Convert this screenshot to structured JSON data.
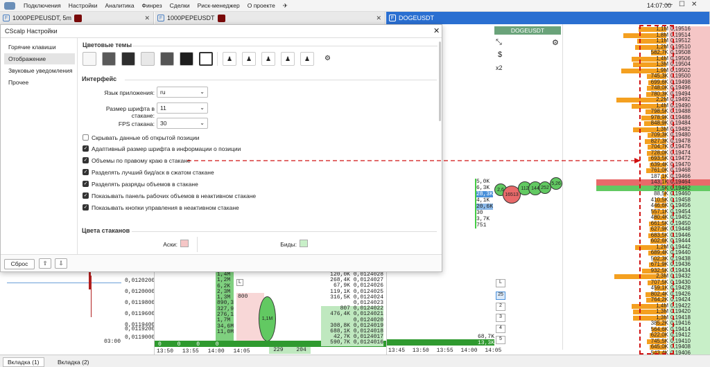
{
  "menu": [
    "Подключения",
    "Настройки",
    "Аналитика",
    "Финрез",
    "Сделки",
    "Риск-менеджер",
    "О проекте"
  ],
  "clock": "14:07:00",
  "tabs": [
    {
      "label": "1000PEPEUSDT, 5m"
    },
    {
      "label": "1000PEPEUSDT"
    },
    {
      "label": "DOGEUSDT"
    }
  ],
  "dialog": {
    "title": "CScalp Настройки",
    "sidebar": [
      "Горячие клавиши",
      "Отображение",
      "Звуковые уведомления",
      "Прочее"
    ],
    "section_themes": "Цветовые темы",
    "section_interface": "Интерфейс",
    "lang_label": "Язык приложения:",
    "lang_value": "ru",
    "font_label": "Размер шрифта в стакане:",
    "font_value": "11",
    "fps_label": "FPS стакана:",
    "fps_value": "30",
    "checkboxes": [
      {
        "label": "Скрывать данные об открытой позиции",
        "checked": false
      },
      {
        "label": "Адаптивный размер шрифта в информации о позиции",
        "checked": true
      },
      {
        "label": "Объемы по правому краю в стакане",
        "checked": true
      },
      {
        "label": "Разделять лучший бид/аск в сжатом стакане",
        "checked": true
      },
      {
        "label": "Разделять разряды объемов в стакане",
        "checked": true
      },
      {
        "label": "Показывать панель рабочих объемов в неактивном стакане",
        "checked": true
      },
      {
        "label": "Показывать кнопки управления в неактивном стакане",
        "checked": true
      }
    ],
    "section_colors": "Цвета стаканов",
    "asks_label": "Аски:",
    "bids_label": "Биды:",
    "reset": "Сброс"
  },
  "doge_header": "DOGEUSDT",
  "x2": "x2",
  "book": [
    {
      "v": "1,1M",
      "p": "0,19516",
      "w": 40
    },
    {
      "v": "1,8M",
      "p": "0,19514",
      "w": 62
    },
    {
      "v": "1,1M",
      "p": "0,19512",
      "w": 42
    },
    {
      "v": "1,2M",
      "p": "0,19510",
      "w": 45
    },
    {
      "v": "582,7K",
      "p": "0,19508",
      "w": 22
    },
    {
      "v": "1,4M",
      "p": "0,19506",
      "w": 50
    },
    {
      "v": "1,3M",
      "p": "0,19504",
      "w": 48
    },
    {
      "v": "1,9M",
      "p": "0,19502",
      "w": 65
    },
    {
      "v": "745,3K",
      "p": "0,19500",
      "w": 28
    },
    {
      "v": "699,6K",
      "p": "0,19498",
      "w": 26
    },
    {
      "v": "748,0K",
      "p": "0,19496",
      "w": 28
    },
    {
      "v": "780,3K",
      "p": "0,19494",
      "w": 29
    },
    {
      "v": "2,2M",
      "p": "0,19492",
      "w": 72
    },
    {
      "v": "1,4M",
      "p": "0,19490",
      "w": 50
    },
    {
      "v": "798,5K",
      "p": "0,19488",
      "w": 30
    },
    {
      "v": "978,9K",
      "p": "0,19486",
      "w": 36
    },
    {
      "v": "848,9K",
      "p": "0,19484",
      "w": 32
    },
    {
      "v": "1,3M",
      "p": "0,19482",
      "w": 48
    },
    {
      "v": "709,3K",
      "p": "0,19480",
      "w": 27
    },
    {
      "v": "827,3K",
      "p": "0,19478",
      "w": 31
    },
    {
      "v": "704,7K",
      "p": "0,19476",
      "w": 27
    },
    {
      "v": "728,0K",
      "p": "0,19474",
      "w": 28
    },
    {
      "v": "693,5K",
      "p": "0,19472",
      "w": 26
    },
    {
      "v": "639,4K",
      "p": "0,19470",
      "w": 24
    },
    {
      "v": "761,0K",
      "p": "0,19468",
      "w": 29
    },
    {
      "v": "187,1K",
      "p": "0,19466",
      "w": 8
    },
    {
      "v": "143,1K",
      "p": "0,19464",
      "w": 6
    },
    {
      "v": "27,5K",
      "p": "0,19462",
      "w": 2
    },
    {
      "v": "88,5K",
      "p": "0,19460",
      "w": 4
    },
    {
      "v": "410,5K",
      "p": "0,19458",
      "w": 16
    },
    {
      "v": "446,6K",
      "p": "0,19456",
      "w": 17
    },
    {
      "v": "557,1K",
      "p": "0,19454",
      "w": 21
    },
    {
      "v": "480,4K",
      "p": "0,19452",
      "w": 18
    },
    {
      "v": "661,5K",
      "p": "0,19450",
      "w": 25
    },
    {
      "v": "627,9K",
      "p": "0,19448",
      "w": 24
    },
    {
      "v": "683,5K",
      "p": "0,19446",
      "w": 26
    },
    {
      "v": "602,6K",
      "p": "0,19444",
      "w": 23
    },
    {
      "v": "1,2M",
      "p": "0,19442",
      "w": 45
    },
    {
      "v": "689,4K",
      "p": "0,19440",
      "w": 26
    },
    {
      "v": "502,3K",
      "p": "0,19438",
      "w": 19
    },
    {
      "v": "671,9K",
      "p": "0,19436",
      "w": 25
    },
    {
      "v": "932,5K",
      "p": "0,19434",
      "w": 35
    },
    {
      "v": "2,3M",
      "p": "0,19432",
      "w": 75
    },
    {
      "v": "707,5K",
      "p": "0,19430",
      "w": 27
    },
    {
      "v": "459,1K",
      "p": "0,19428",
      "w": 17
    },
    {
      "v": "802,4K",
      "p": "0,19426",
      "w": 30
    },
    {
      "v": "764,2K",
      "p": "0,19424",
      "w": 29
    },
    {
      "v": "1,4M",
      "p": "0,19422",
      "w": 50
    },
    {
      "v": "1,3M",
      "p": "0,19420",
      "w": 48
    },
    {
      "v": "1,3M",
      "p": "0,19418",
      "w": 48
    },
    {
      "v": "385,2K",
      "p": "0,19416",
      "w": 15
    },
    {
      "v": "564,6K",
      "p": "0,19414",
      "w": 21
    },
    {
      "v": "622,0K",
      "p": "0,19412",
      "w": 24
    },
    {
      "v": "745,5K",
      "p": "0,19410",
      "w": 28
    },
    {
      "v": "645,0K",
      "p": "0,19408",
      "w": 24
    },
    {
      "v": "543,4K",
      "p": "0,19406",
      "w": 20
    }
  ],
  "clusters": [
    "5,0K",
    "6,3K",
    "28,3K",
    "4,1K",
    "20,6K",
    "30",
    "3,7K",
    "751"
  ],
  "bubbles": [
    "2,6",
    "16513",
    "112",
    "144",
    "252",
    "5,26"
  ],
  "lower_prices": [
    "0,0120200",
    "0,0120000",
    "0,0119800",
    "0,0119600",
    "0,0119400",
    "0,0119200",
    "0,0119000"
  ],
  "time_label": "03:00",
  "mid_vols": [
    "1,4M",
    "1,2M",
    "6,2K",
    "2,3M",
    "1,3M",
    "890,3",
    "327,9",
    "276,1",
    "1,7M",
    "34,6M",
    "11,0M"
  ],
  "book2": [
    {
      "v": "120,0K",
      "p": "0,0124028"
    },
    {
      "v": "268,4K",
      "p": "0,0124027"
    },
    {
      "v": "67,9K",
      "p": "0,0124026"
    },
    {
      "v": "119,1K",
      "p": "0,0124025"
    },
    {
      "v": "316,5K",
      "p": "0,0124024"
    },
    {
      "v": "",
      "p": "0,0124023"
    },
    {
      "v": "807",
      "p": "0,0124022"
    },
    {
      "v": "476,4K",
      "p": "0,0124021"
    },
    {
      "v": "",
      "p": "0,0124020"
    },
    {
      "v": "308,8K",
      "p": "0,0124019"
    },
    {
      "v": "688,1K",
      "p": "0,0124018"
    },
    {
      "v": "42,7K",
      "p": "0,0124017"
    },
    {
      "v": "590,7K",
      "p": "0,0124016"
    }
  ],
  "times_mid": [
    "13:50",
    "13:55",
    "14:00",
    "14:05"
  ],
  "times_right": [
    "13:45",
    "13:50",
    "13:55",
    "14:00",
    "14:05"
  ],
  "bottom_nums": [
    "229",
    "204"
  ],
  "bubble_big": "1,1M",
  "right_small": [
    "68,7K",
    "13,3K",
    "0",
    "0",
    "0",
    "0",
    "0"
  ],
  "scale_btns": [
    "L",
    "25",
    "2",
    "3",
    "4",
    "5"
  ],
  "bottom_tabs": [
    "Вкладка (1)",
    "Вкладка (2)"
  ]
}
